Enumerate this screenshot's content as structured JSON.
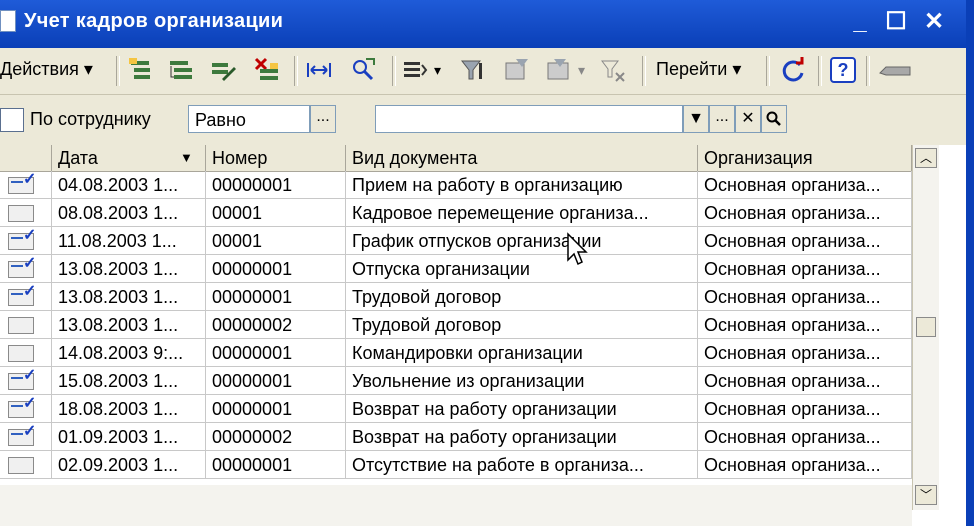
{
  "window": {
    "title": "Учет кадров организации",
    "minimize": "_",
    "maximize": "☐",
    "close": "✕"
  },
  "toolbar": {
    "actions_label": "Действия ▾",
    "goto_label": "Перейти ▾",
    "help_label": "?"
  },
  "filter": {
    "checkbox_label": "По сотруднику",
    "condition": "Равно",
    "ellipsis": "...",
    "value": "",
    "dropdown": "▼",
    "clear": "✕",
    "search": "🔍"
  },
  "table": {
    "columns": [
      "Дата",
      "Номер",
      "Вид документа",
      "Организация"
    ],
    "sort_indicator": "▼",
    "rows": [
      {
        "icon": "posted",
        "date": "04.08.2003 1...",
        "number": "00000001",
        "type": "Прием на работу в организацию",
        "org": "Основная организа..."
      },
      {
        "icon": "draft",
        "date": "08.08.2003 1...",
        "number": "00001",
        "type": "Кадровое перемещение организа...",
        "org": "Основная организа..."
      },
      {
        "icon": "posted",
        "date": "11.08.2003 1...",
        "number": "00001",
        "type": "График отпусков организации",
        "org": "Основная организа..."
      },
      {
        "icon": "posted",
        "date": "13.08.2003 1...",
        "number": "00000001",
        "type": "Отпуска организации",
        "org": "Основная организа..."
      },
      {
        "icon": "posted",
        "date": "13.08.2003 1...",
        "number": "00000001",
        "type": "Трудовой договор",
        "org": "Основная организа..."
      },
      {
        "icon": "draft",
        "date": "13.08.2003 1...",
        "number": "00000002",
        "type": "Трудовой договор",
        "org": "Основная организа..."
      },
      {
        "icon": "draft",
        "date": "14.08.2003 9:...",
        "number": "00000001",
        "type": "Командировки организации",
        "org": "Основная организа..."
      },
      {
        "icon": "posted",
        "date": "15.08.2003 1...",
        "number": "00000001",
        "type": "Увольнение из организации",
        "org": "Основная организа..."
      },
      {
        "icon": "posted",
        "date": "18.08.2003 1...",
        "number": "00000001",
        "type": "Возврат на работу организации",
        "org": "Основная организа..."
      },
      {
        "icon": "posted",
        "date": "01.09.2003 1...",
        "number": "00000002",
        "type": "Возврат на работу организации",
        "org": "Основная организа..."
      },
      {
        "icon": "draft",
        "date": "02.09.2003 1...",
        "number": "00000001",
        "type": "Отсутствие на работе в организа...",
        "org": "Основная организа..."
      }
    ]
  },
  "scroll": {
    "up": "︿",
    "down": "﹀"
  },
  "colors": {
    "titlebar": "#0a3fb7",
    "toolbar": "#ece9d8",
    "icon_blue": "#1a3fc0"
  }
}
